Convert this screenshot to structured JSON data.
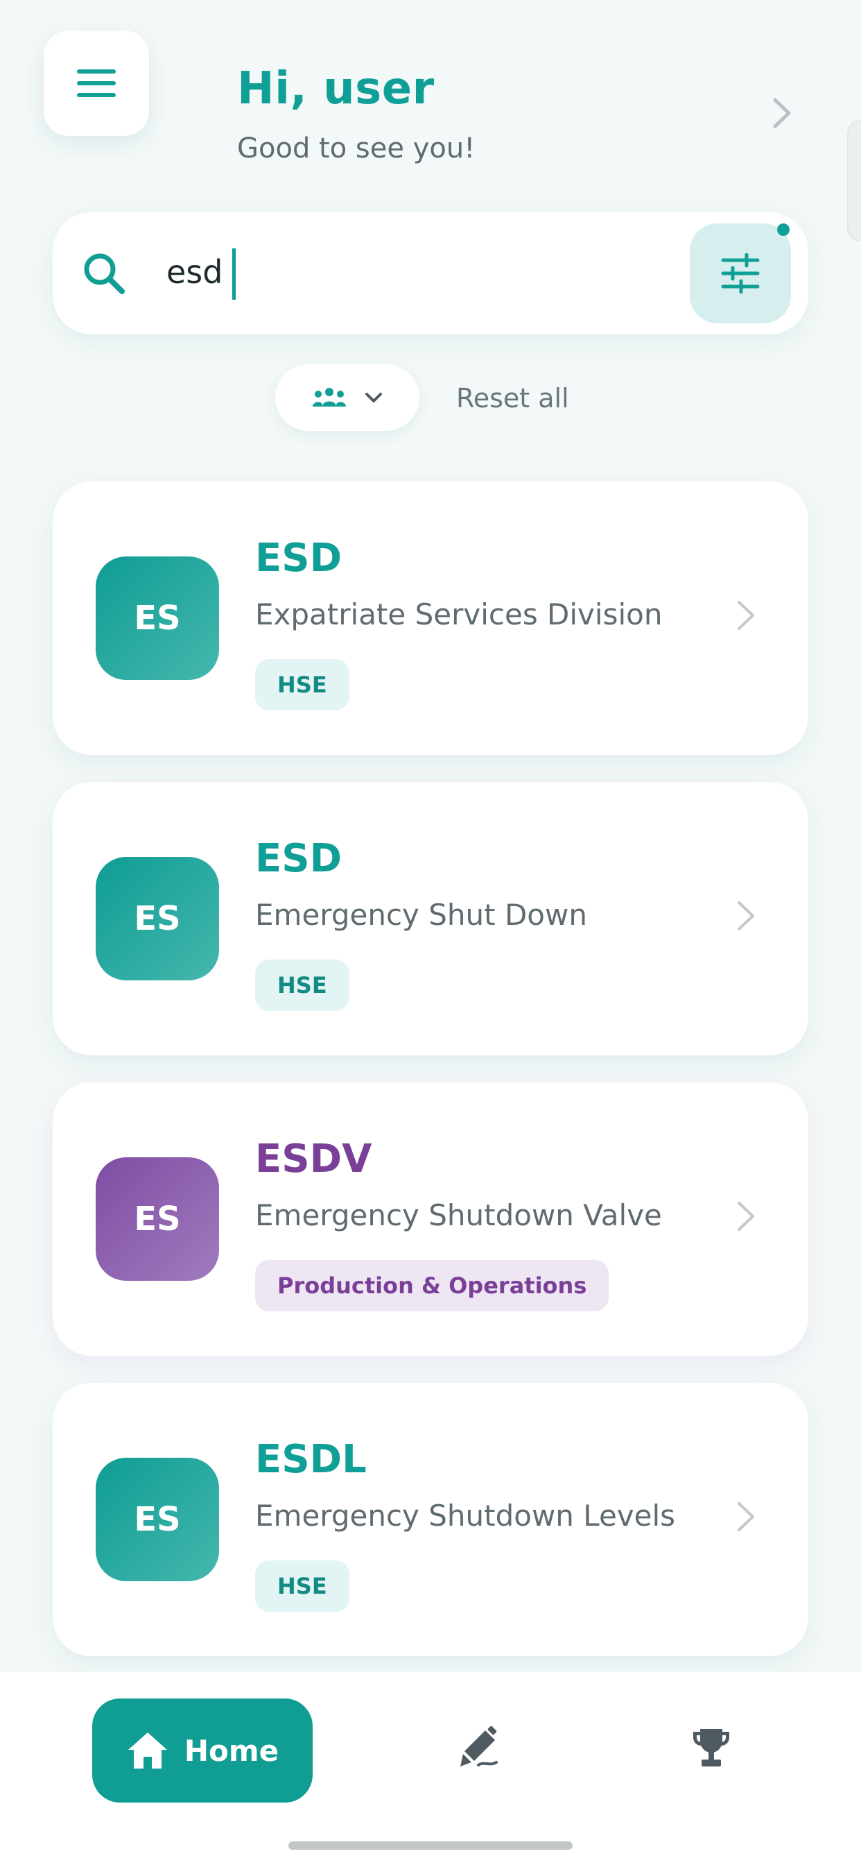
{
  "header": {
    "greeting": "Hi, user",
    "subtitle": "Good to see you!",
    "menu_icon": "menu-icon",
    "chevron_icon": "chevron-right-icon"
  },
  "search": {
    "value": "esd",
    "icon": "search-icon",
    "filter_icon": "sliders-icon",
    "filter_active": true
  },
  "filters": {
    "team_icon": "team-icon",
    "dropdown_icon": "chevron-down-icon",
    "reset_label": "Reset all"
  },
  "results": [
    {
      "initials": "ES",
      "abbreviation": "ESD",
      "full_name": "Expatriate Services Division",
      "tag": "HSE",
      "color": "#109f96"
    },
    {
      "initials": "ES",
      "abbreviation": "ESD",
      "full_name": "Emergency Shut Down",
      "tag": "HSE",
      "color": "#109f96"
    },
    {
      "initials": "ES",
      "abbreviation": "ESDV",
      "full_name": "Emergency Shutdown Valve",
      "tag": "Production & Operations",
      "color": "#7a3f97"
    },
    {
      "initials": "ES",
      "abbreviation": "ESDL",
      "full_name": "Emergency Shutdown Levels",
      "tag": "HSE",
      "color": "#109f96"
    }
  ],
  "bottom_nav": {
    "home_label": "Home",
    "home_icon": "home-icon",
    "edit_icon": "edit-pen-icon",
    "trophy_icon": "trophy-icon"
  },
  "colors": {
    "accent": "#109f96",
    "purple": "#7a3f97",
    "background": "#f3f8f8"
  }
}
